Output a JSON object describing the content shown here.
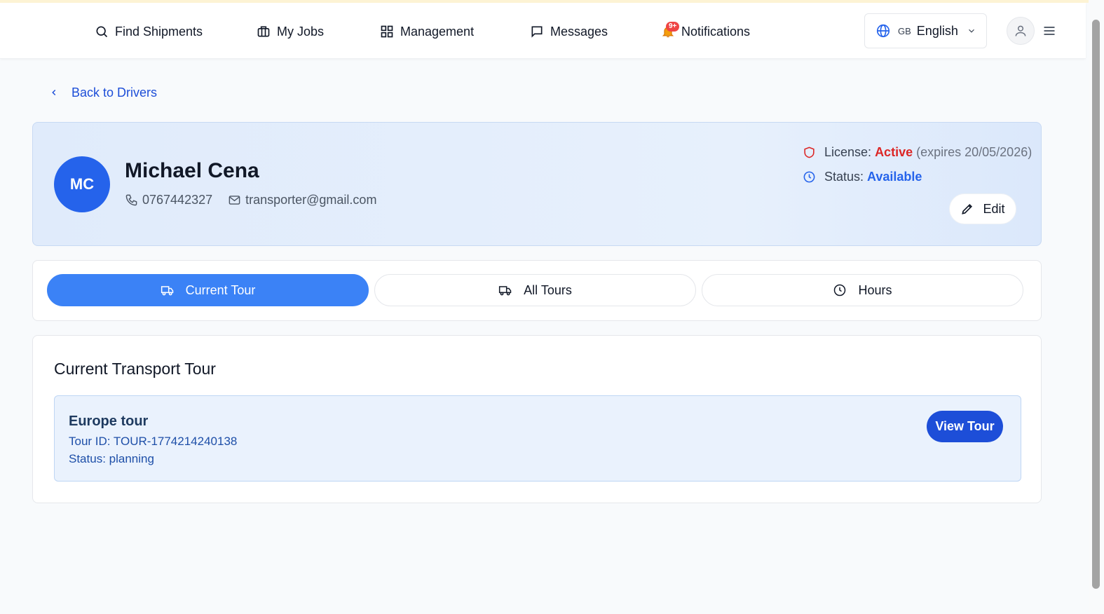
{
  "nav": {
    "find_shipments": "Find Shipments",
    "my_jobs": "My Jobs",
    "management": "Management",
    "messages": "Messages",
    "notifications": "Notifications",
    "notifications_badge": "9+"
  },
  "language": {
    "flag_code": "GB",
    "label": "English"
  },
  "back_link": "Back to Drivers",
  "driver": {
    "initials": "MC",
    "name": "Michael Cena",
    "phone": "0767442327",
    "email": "transporter@gmail.com",
    "license_label": "License:",
    "license_value": "Active",
    "license_expires": "(expires 20/05/2026)",
    "status_label": "Status:",
    "status_value": "Available",
    "edit_label": "Edit"
  },
  "tabs": [
    {
      "label": "Current Tour",
      "active": true,
      "icon": "truck-icon"
    },
    {
      "label": "All Tours",
      "active": false,
      "icon": "truck-icon"
    },
    {
      "label": "Hours",
      "active": false,
      "icon": "clock-icon"
    }
  ],
  "current_tour": {
    "heading": "Current Transport Tour",
    "name": "Europe tour",
    "tour_id": "Tour ID: TOUR-1774214240138",
    "status": "Status: planning",
    "view_label": "View Tour"
  },
  "colors": {
    "primary": "#2563eb",
    "active_tab": "#3b82f6",
    "license_active": "#dc2626",
    "badge": "#ef4444"
  }
}
